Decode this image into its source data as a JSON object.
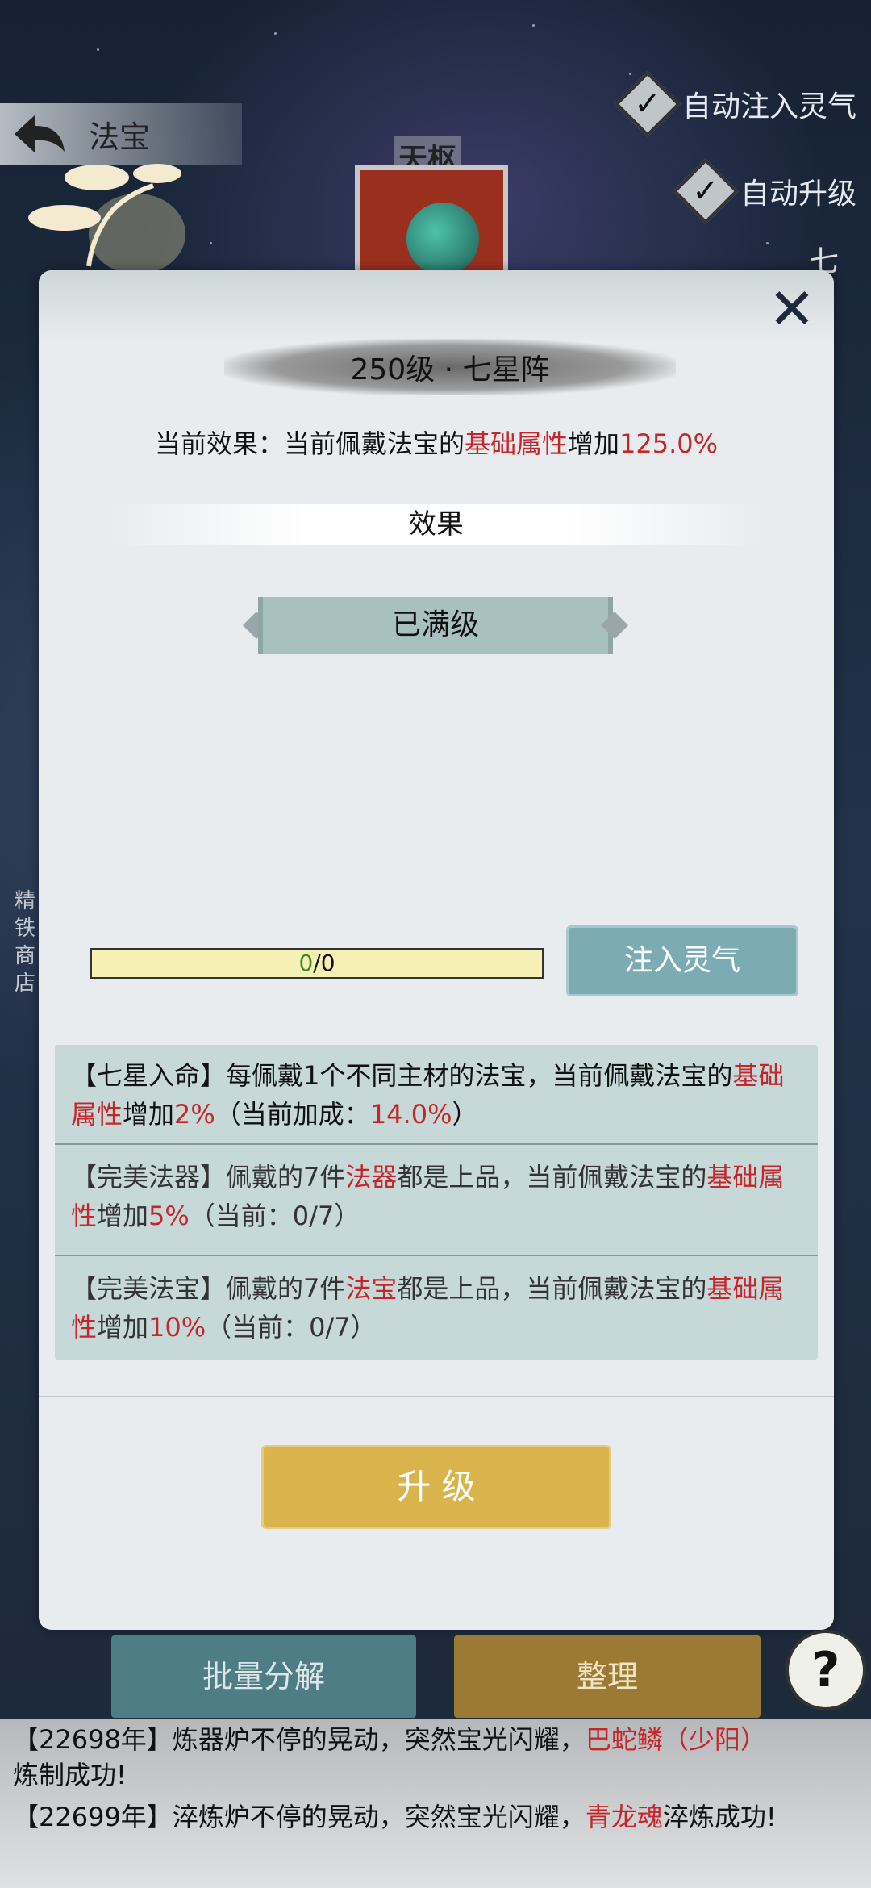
{
  "header": {
    "title": "法宝",
    "auto_inject_label": "自动注入灵气",
    "auto_upgrade_label": "自动升级",
    "formation_name": "天枢",
    "side_char": "七",
    "left_shop": "精\n铁\n商\n店"
  },
  "modal": {
    "title": "250级 · 七星阵",
    "effect_prefix": "当前效果：当前佩戴法宝的",
    "effect_attr": "基础属性",
    "effect_mid": "增加",
    "effect_value": "125.0%",
    "effect_section_label": "效果",
    "max_level_label": "已满级",
    "progress": {
      "current": "0",
      "separator": "/",
      "max": "0"
    },
    "inject_button": "注入灵气",
    "bonuses": [
      {
        "prefix": "【七星入命】每佩戴1个不同主材的法宝，当前佩戴法宝的",
        "attr": "基础属性",
        "mid": "增加",
        "value": "2%",
        "suffix": "（当前加成：",
        "current": "14.0%",
        "end": "）"
      },
      {
        "prefix": "【完美法器】佩戴的7件",
        "item": "法器",
        "mid1": "都是上品，当前佩戴法宝的",
        "attr": "基础属性",
        "mid2": "增加",
        "value": "5%",
        "suffix": "（当前：0/7）"
      },
      {
        "prefix": "【完美法宝】佩戴的7件",
        "item": "法宝",
        "mid1": "都是上品，当前佩戴法宝的",
        "attr": "基础属性",
        "mid2": "增加",
        "value": "10%",
        "suffix": "（当前：0/7）"
      }
    ],
    "upgrade_button": "升 级"
  },
  "footer": {
    "bulk_button": "批量分解",
    "sort_button": "整理",
    "help_button": "?"
  },
  "log": [
    {
      "pre": "【22698年】炼器炉不停的晃动，突然宝光闪耀，",
      "item": "巴蛇鳞（少阳）",
      "post": "炼制成功!"
    },
    {
      "pre": "【22699年】淬炼炉不停的晃动，突然宝光闪耀，",
      "item": "青龙魂",
      "post": "淬炼成功!"
    }
  ],
  "colors": {
    "accent_red": "#c4272b",
    "gold_button": "#d9b44d",
    "teal_button": "#7cabb3"
  }
}
